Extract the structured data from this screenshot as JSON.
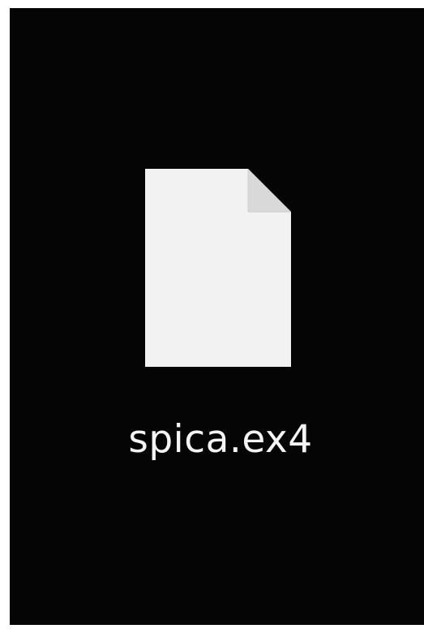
{
  "desktop": {
    "items": [
      {
        "name": "spica.ex4",
        "icon": "blank-file-icon"
      }
    ]
  },
  "colors": {
    "background": "#050505",
    "file_icon": "#f4f4f4",
    "label_text": "#f4f4f4"
  }
}
